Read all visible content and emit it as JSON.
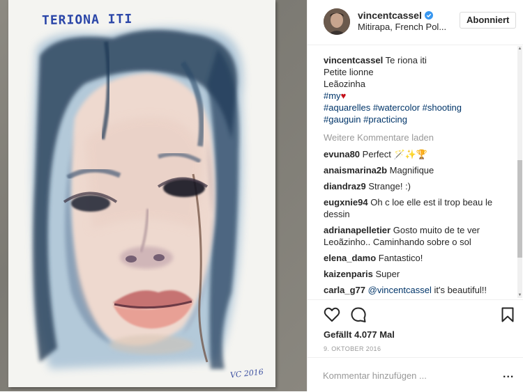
{
  "photo": {
    "painting_title": "TERIONA ITI",
    "signature": "VC 2016"
  },
  "header": {
    "username": "vincentcassel",
    "location": "Mitirapa, French Polynesia",
    "location_display": "Mitirapa, French Pol...",
    "follow_label": "Abonniert",
    "verified_icon": "verified-badge-icon"
  },
  "caption": {
    "user": "vincentcassel",
    "line1": "Te riona iti",
    "line2": "Petite lionne",
    "line3": "Leãozinha",
    "line4_tag": "#my",
    "line4_emoji": "♥",
    "line5": "#aquarelles #watercolor #shooting",
    "line6": "#gauguin #practicing"
  },
  "load_more": "Weitere Kommentare laden",
  "comments": [
    {
      "user": "evuna80",
      "text": "Perfect 🪄✨🏆"
    },
    {
      "user": "anaismarina2b",
      "text": "Magnifique"
    },
    {
      "user": "diandraz9",
      "text": "Strange! :)"
    },
    {
      "user": "eugxnie94",
      "text": "Oh c loe elle est il trop beau le dessin"
    },
    {
      "user": "adrianapelletier",
      "text": "Gosto muito de te ver Leoãzinho.. Caminhando sobre o sol"
    },
    {
      "user": "elena_damo",
      "text": "Fantastico!"
    },
    {
      "user": "kaizenparis",
      "text": "Super"
    },
    {
      "user": "carla_g77",
      "mention": "@vincentcassel",
      "text": " it's beautiful!!"
    }
  ],
  "actions": {
    "like_icon": "heart-icon",
    "comment_icon": "speech-bubble-icon",
    "save_icon": "bookmark-icon",
    "likes": "Gefällt 4.077 Mal",
    "date": "9. OKTOBER 2016"
  },
  "add_comment": {
    "placeholder": "Kommentar hinzufügen ...",
    "more_label": "..."
  },
  "colors": {
    "link": "#003569",
    "verified": "#3897f0",
    "muted": "#999999",
    "heart": "#c4111b"
  }
}
